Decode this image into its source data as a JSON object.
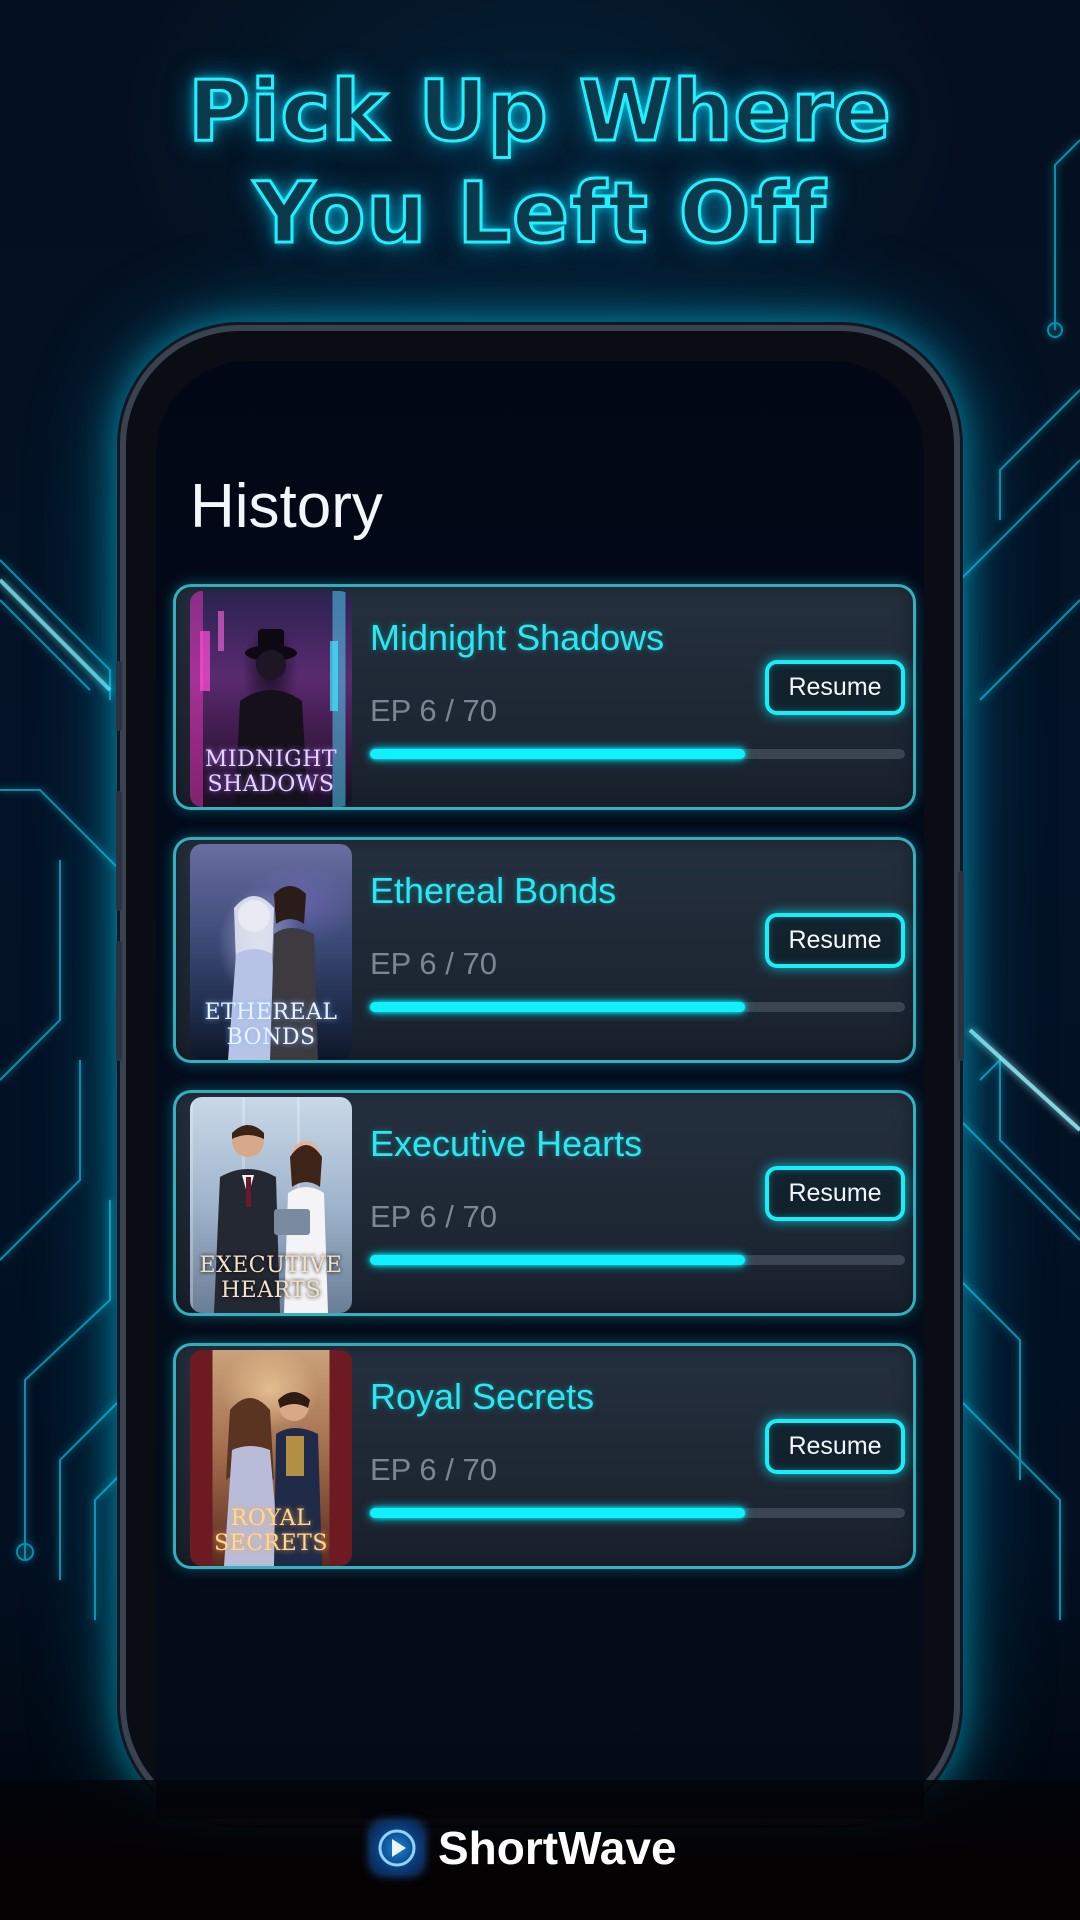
{
  "headline": {
    "line1": "Pick Up Where",
    "line2": "You Left Off"
  },
  "screen": {
    "title": "History",
    "history": [
      {
        "title": "Midnight Shadows",
        "cover_text_1": "MIDNIGHT",
        "cover_text_2": "SHADOWS",
        "episode": "EP 6 / 70",
        "progress": 0.7,
        "resume_label": "Resume"
      },
      {
        "title": "Ethereal Bonds",
        "cover_text_1": "ETHEREAL",
        "cover_text_2": "BONDS",
        "episode": "EP 6 / 70",
        "progress": 0.7,
        "resume_label": "Resume"
      },
      {
        "title": "Executive Hearts",
        "cover_text_1": "EXECUTIVE",
        "cover_text_2": "HEARTS",
        "episode": "EP 6 / 70",
        "progress": 0.7,
        "resume_label": "Resume"
      },
      {
        "title": "Royal Secrets",
        "cover_text_1": "ROYAL",
        "cover_text_2": "SECRETS",
        "episode": "EP 6 / 70",
        "progress": 0.7,
        "resume_label": "Resume"
      }
    ]
  },
  "brand": {
    "name": "ShortWave",
    "icon": "play-wave-logo-icon"
  },
  "colors": {
    "accent": "#10f0ff",
    "title_text": "#2ee6ef",
    "muted_text": "#7c8593",
    "background": "#031226"
  }
}
